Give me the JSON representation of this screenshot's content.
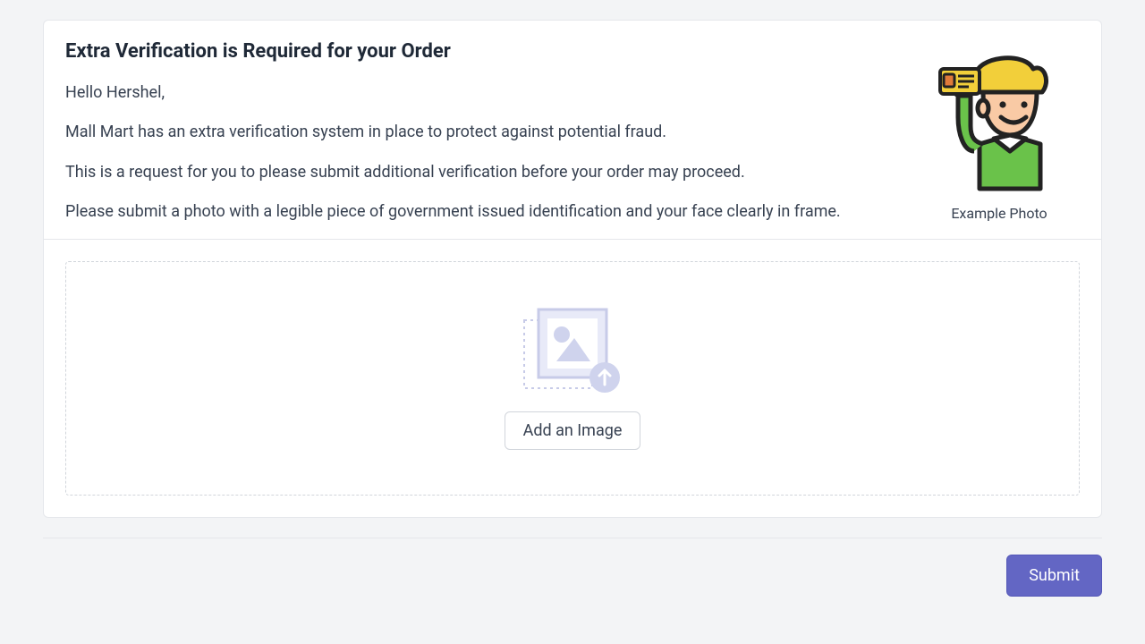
{
  "title": "Extra Verification is Required for your Order",
  "greeting": "Hello Hershel,",
  "p1": "Mall Mart has an extra verification system in place to protect against potential fraud.",
  "p2": "This is a request for you to please submit additional verification before your order may proceed.",
  "p3": "Please submit a photo with a legible piece of government issued identification and your face clearly in frame.",
  "example_caption": "Example Photo",
  "upload": {
    "add_label": "Add an Image"
  },
  "actions": {
    "submit_label": "Submit"
  }
}
